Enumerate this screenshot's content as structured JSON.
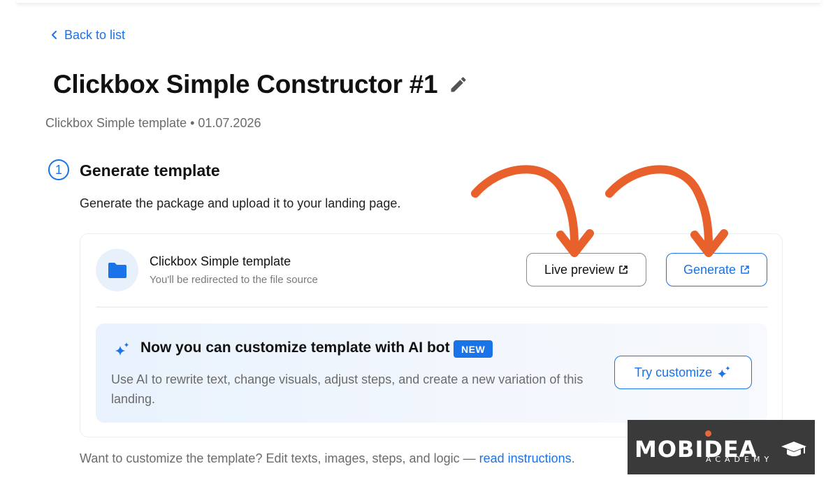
{
  "nav": {
    "back_label": "Back to list"
  },
  "page": {
    "title": "Clickbox Simple Constructor #1",
    "subtitle": "Clickbox Simple template • 01.07.2026"
  },
  "step": {
    "number": "1",
    "title": "Generate template",
    "description": "Generate the package and upload it to your landing page."
  },
  "file": {
    "name": "Clickbox Simple template",
    "note": "You'll be redirected to the file source",
    "icon": "folder-icon"
  },
  "buttons": {
    "live_preview": "Live preview",
    "generate": "Generate",
    "try_customize": "Try customize"
  },
  "ai": {
    "title": "Now you can customize template with AI bot",
    "badge": "NEW",
    "description": "Use AI to rewrite text, change visuals, adjust steps, and create a new variation of this landing."
  },
  "footer": {
    "text": "Want to customize the template? Edit texts, images, steps, and logic — ",
    "link": "read instructions",
    "suffix": "."
  },
  "watermark": {
    "brand": "MOBIDEA",
    "sub": "ACADEMY"
  },
  "colors": {
    "accent": "#1a73e8",
    "annotation_arrow": "#e8602c",
    "watermark_bg": "#3a3a3a"
  }
}
